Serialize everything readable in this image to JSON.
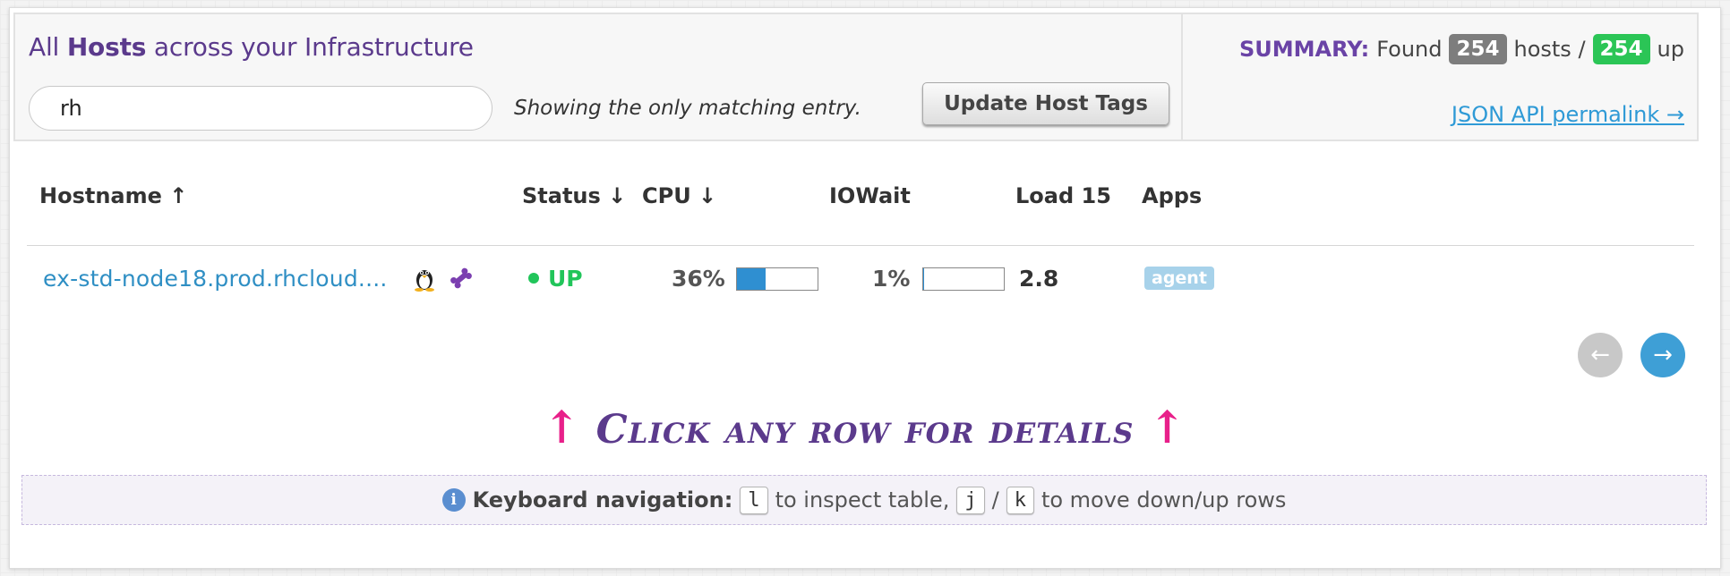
{
  "header": {
    "title_prefix": "All",
    "title_strong": "Hosts",
    "title_suffix": "across your Infrastructure",
    "search_value": "rh",
    "match_note": "Showing the only matching entry.",
    "update_tags_label": "Update Host Tags"
  },
  "summary": {
    "label": "SUMMARY:",
    "found_text": "Found",
    "hosts_count": "254",
    "hosts_text": "hosts /",
    "up_count": "254",
    "up_text": "up",
    "api_link": "JSON API permalink →"
  },
  "table": {
    "columns": {
      "hostname": "Hostname ↑",
      "status": "Status ↓",
      "cpu": "CPU ↓",
      "iowait": "IOWait",
      "load15": "Load 15",
      "apps": "Apps"
    },
    "rows": [
      {
        "hostname": "ex-std-node18.prod.rhcloud....",
        "os_icon": "linux-penguin-icon",
        "agent_icon": "bone-icon",
        "status": "UP",
        "cpu_pct": "36%",
        "cpu_value": 36,
        "iowait_pct": "1%",
        "iowait_value": 1,
        "load15": "2.8",
        "app": "agent"
      }
    ]
  },
  "pagination": {
    "prev_icon": "arrow-left-icon",
    "next_icon": "arrow-right-icon",
    "prev_glyph": "←",
    "next_glyph": "→"
  },
  "hint": {
    "arrow_glyph": "↑",
    "text": "Click any row for details"
  },
  "keyboard": {
    "title": "Keyboard navigation:",
    "key_inspect": "l",
    "inspect_text": "to inspect table,",
    "key_down": "j",
    "separator": "/",
    "key_up": "k",
    "move_text": "to move down/up rows"
  },
  "colors": {
    "accent_purple": "#5b3a8c",
    "link_blue": "#2f8fc4",
    "status_green": "#21c55a",
    "hint_pink": "#e8208a"
  }
}
